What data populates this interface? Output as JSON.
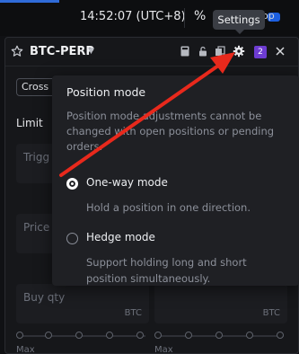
{
  "topbar": {
    "time": "14:52:07 (UTC+8)",
    "percent_icon": "%",
    "op_text": "op"
  },
  "tooltip": {
    "text": "Settings"
  },
  "header": {
    "star_icon": "star-outline",
    "market": "BTC-PERP",
    "caret_icon": "caret-down",
    "badge_count": "2",
    "icons": [
      "calculator-icon",
      "lock-icon",
      "copy-icon",
      "gear-icon",
      "close-icon"
    ]
  },
  "form": {
    "margin_mode": "Cross",
    "order_tab": "Limit",
    "trigger_label": "Trigg",
    "price_label": "Price",
    "buy_qty_label": "Buy qty",
    "buy_unit": "BTC",
    "sell_unit": "BTC",
    "max_left": "Max",
    "max_right": "Max"
  },
  "position_mode": {
    "title": "Position mode",
    "description": "Position mode adjustments cannot be changed with open positions or pending orders.",
    "options": [
      {
        "label": "One-way mode",
        "description": "Hold a position in one direction.",
        "selected": true
      },
      {
        "label": "Hedge mode",
        "description": "Support holding long and short position simultaneously.",
        "selected": false
      }
    ]
  },
  "colors": {
    "accent_badge": "#6d3cd1",
    "annotation_arrow": "#e8291c",
    "top_accent": "#2f6bd8"
  }
}
